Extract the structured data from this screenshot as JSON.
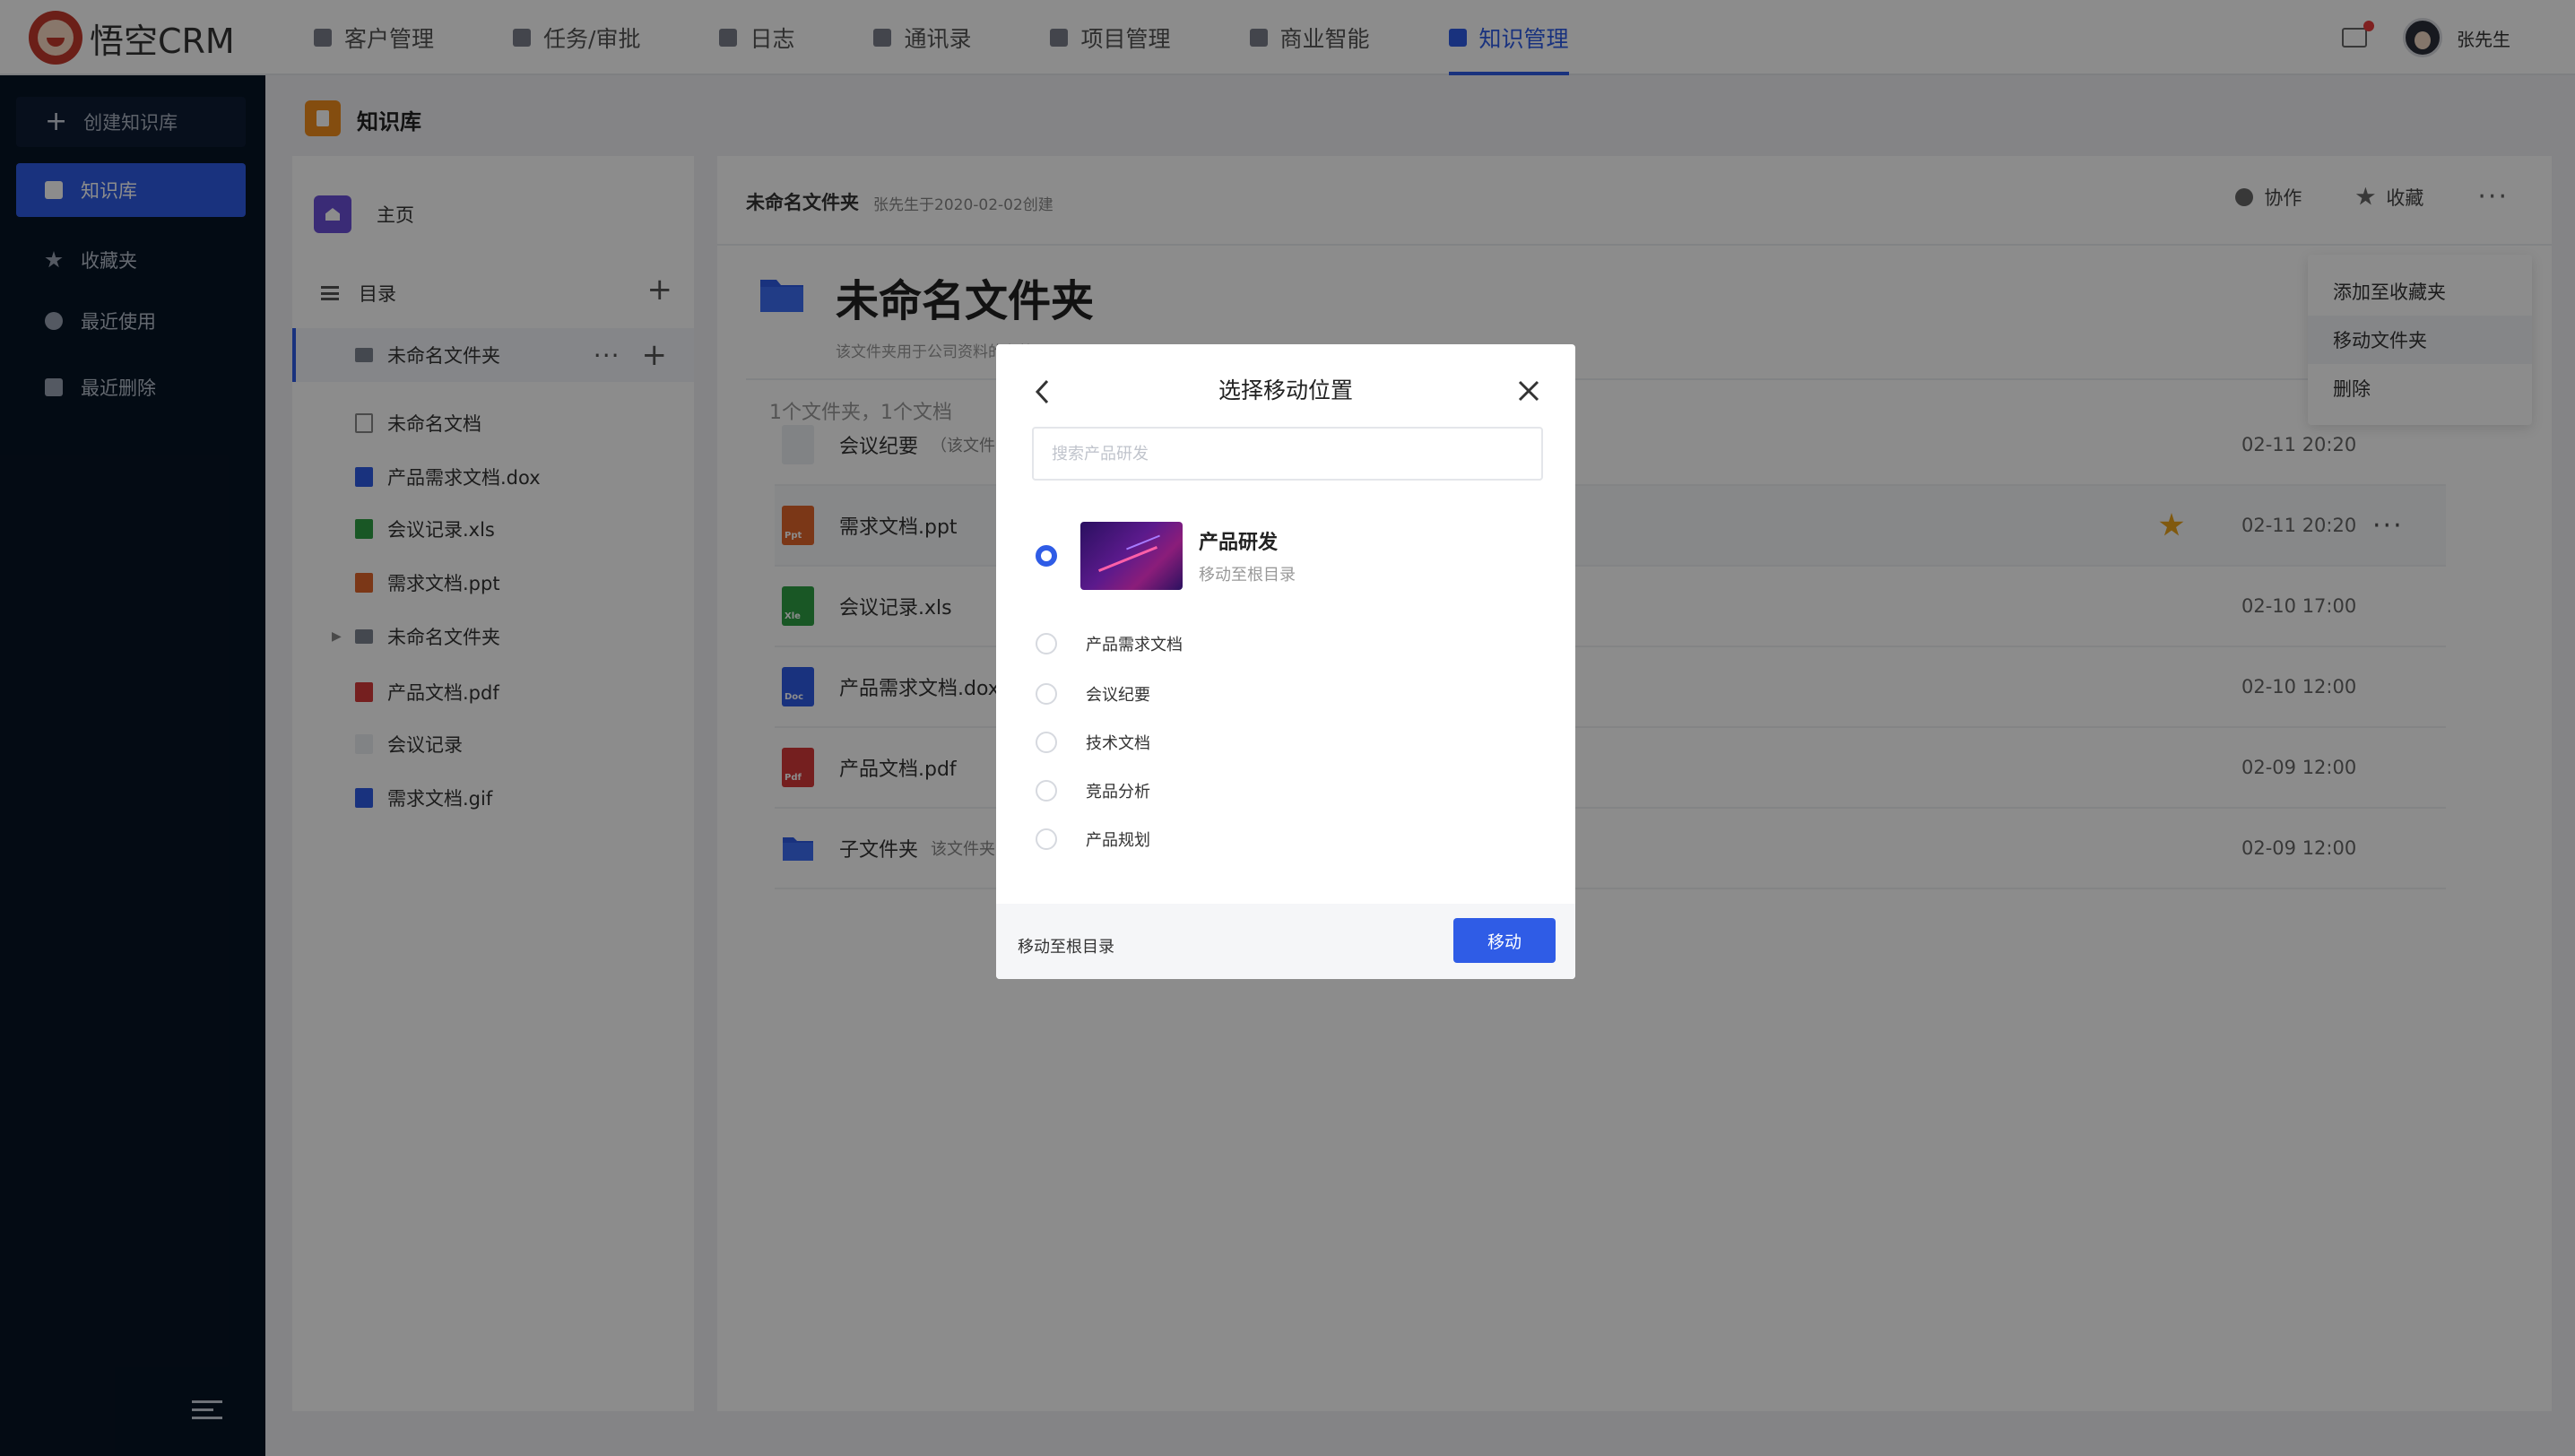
{
  "app": {
    "logo_text": "悟空CRM",
    "brand_color": "#c43a2d",
    "accent": "#2f5ce6"
  },
  "topnav": [
    {
      "label": "客户管理",
      "icon": "building-icon"
    },
    {
      "label": "任务/审批",
      "icon": "briefcase-icon"
    },
    {
      "label": "日志",
      "icon": "log-icon"
    },
    {
      "label": "通讯录",
      "icon": "contacts-icon"
    },
    {
      "label": "项目管理",
      "icon": "project-icon"
    },
    {
      "label": "商业智能",
      "icon": "bi-icon"
    },
    {
      "label": "知识管理",
      "icon": "book-icon",
      "active": true
    }
  ],
  "user": {
    "name": "张先生"
  },
  "sidebar": {
    "create_label": "创建知识库",
    "items": [
      {
        "label": "知识库",
        "icon": "book-icon",
        "active": true
      },
      {
        "label": "收藏夹",
        "icon": "star-icon"
      },
      {
        "label": "最近使用",
        "icon": "clock-icon"
      },
      {
        "label": "最近删除",
        "icon": "trash-icon"
      }
    ]
  },
  "page": {
    "title": "知识库"
  },
  "tree": {
    "home_label": "主页",
    "dir_label": "目录",
    "items": [
      {
        "label": "未命名文件夹",
        "type": "folder"
      },
      {
        "label": "未命名文档",
        "type": "doc"
      },
      {
        "label": "产品需求文档.dox",
        "type": "word"
      },
      {
        "label": "会议记录.xls",
        "type": "excel"
      },
      {
        "label": "需求文档.ppt",
        "type": "ppt"
      },
      {
        "label": "未命名文件夹",
        "type": "folder"
      },
      {
        "label": "产品文档.pdf",
        "type": "pdf"
      },
      {
        "label": "会议记录",
        "type": "blank"
      },
      {
        "label": "需求文档.gif",
        "type": "image"
      }
    ]
  },
  "main": {
    "header_title": "未命名文件夹",
    "header_sub": "张先生于2020-02-02创建",
    "collab_label": "协作",
    "fav_label": "收藏",
    "folder_title": "未命名文件夹",
    "folder_desc": "该文件夹用于公司资料的存放",
    "count_line": "1个文件夹，1个文档",
    "files": [
      {
        "name": "会议纪要",
        "note": "（该文件夹",
        "time": "02-11 20:20",
        "type": "blank"
      },
      {
        "name": "需求文档.ppt",
        "note": "",
        "time": "02-11 20:20",
        "type": "ppt",
        "ext": "Ppt",
        "starred": true
      },
      {
        "name": "会议记录.xls",
        "note": "",
        "time": "02-10 17:00",
        "type": "excel",
        "ext": "Xle"
      },
      {
        "name": "产品需求文档.dox",
        "note": "",
        "time": "02-10 12:00",
        "type": "word",
        "ext": "Doc"
      },
      {
        "name": "产品文档.pdf",
        "note": "",
        "time": "02-09 12:00",
        "type": "pdf",
        "ext": "Pdf"
      },
      {
        "name": "子文件夹",
        "note": "该文件夹",
        "time": "02-09 12:00",
        "type": "folder"
      }
    ]
  },
  "dropdown": {
    "items": [
      "添加至收藏夹",
      "移动文件夹",
      "删除"
    ]
  },
  "modal": {
    "title": "选择移动位置",
    "search_placeholder": "搜索产品研发",
    "main_option": {
      "title": "产品研发",
      "sub": "移动至根目录"
    },
    "options": [
      "产品需求文档",
      "会议纪要",
      "技术文档",
      "竞品分析",
      "产品规划"
    ],
    "root_label": "移动至根目录",
    "move_label": "移动"
  }
}
